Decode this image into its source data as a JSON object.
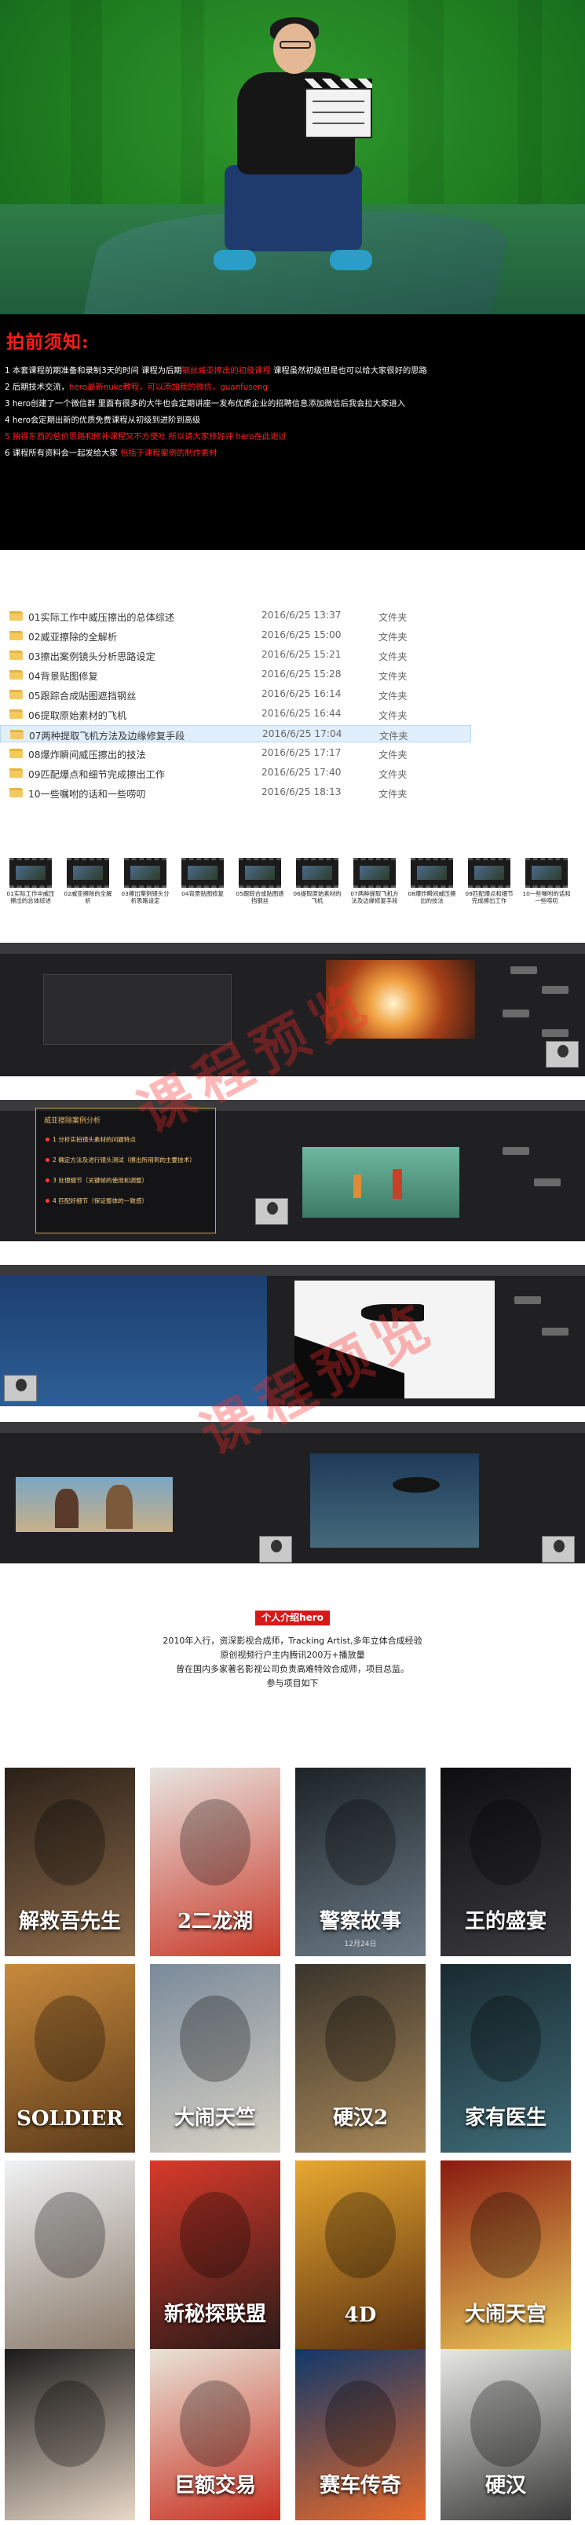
{
  "notice": {
    "title": "拍前须知:",
    "lines": [
      {
        "segments": [
          {
            "text": "1 本套课程前期准备和录制3天的时间 课程为后期",
            "red": false
          },
          {
            "text": "钢丝威亚擦出的初级课程",
            "red": true
          },
          {
            "text": "  课程虽然初级但是也可以给大家很好的思路",
            "red": false
          }
        ]
      },
      {
        "segments": [
          {
            "text": "2 后期技术交流，",
            "red": false
          },
          {
            "text": "hero最新nuke教程，可以添加我的微信，guanfuseng",
            "red": true
          }
        ]
      },
      {
        "segments": [
          {
            "text": "3 hero创建了一个微信群 里面有很多的大牛也会定期讲座一发布优质企业的招聘信息添加微信后我会拉大家进入",
            "red": false
          }
        ]
      },
      {
        "segments": [
          {
            "text": "4 hero会定期出新的优质免费课程从初级到进阶到高级",
            "red": false
          }
        ]
      },
      {
        "segments": [
          {
            "text": "5 拍得东西的总价思路和修补课程又不方便吐 所以请大家修好评 hero在此谢过",
            "red": true
          }
        ]
      },
      {
        "segments": [
          {
            "text": "6 课程所有资料会一起发给大家 ",
            "red": false
          },
          {
            "text": "包括于课程案例的制作素材",
            "red": true
          }
        ]
      }
    ]
  },
  "file_list": {
    "items": [
      {
        "name": "01实际工作中威压擦出的总体综述",
        "date": "2016/6/25 13:37",
        "type": "文件夹",
        "selected": false
      },
      {
        "name": "02威亚擦除的全解析",
        "date": "2016/6/25 15:00",
        "type": "文件夹",
        "selected": false
      },
      {
        "name": "03擦出案例镜头分析思路设定",
        "date": "2016/6/25 15:21",
        "type": "文件夹",
        "selected": false
      },
      {
        "name": "04背景贴图修复",
        "date": "2016/6/25 15:28",
        "type": "文件夹",
        "selected": false
      },
      {
        "name": "05跟踪合成贴图遮挡钢丝",
        "date": "2016/6/25 16:14",
        "type": "文件夹",
        "selected": false
      },
      {
        "name": "06提取原始素材的飞机",
        "date": "2016/6/25 16:44",
        "type": "文件夹",
        "selected": false
      },
      {
        "name": "07两种提取飞机方法及边缘修复手段",
        "date": "2016/6/25 17:04",
        "type": "文件夹",
        "selected": true
      },
      {
        "name": "08爆炸瞬间威压擦出的技法",
        "date": "2016/6/25 17:17",
        "type": "文件夹",
        "selected": false
      },
      {
        "name": "09匹配爆点和细节完成擦出工作",
        "date": "2016/6/25 17:40",
        "type": "文件夹",
        "selected": false
      },
      {
        "name": "10一些嘱咐的话和一些唠叨",
        "date": "2016/6/25 18:13",
        "type": "文件夹",
        "selected": false
      }
    ]
  },
  "thumbnails": [
    "01实际工作中威压擦出的总体综述",
    "02威亚擦除的全解析",
    "03擦出案例镜头分析思路设定",
    "04背景贴图修复",
    "05跟踪合成贴图遮挡钢丝",
    "06提取原始素材的飞机",
    "07两种提取飞机方法及边缘修复手段",
    "08爆炸瞬间威压擦出的技法",
    "09匹配爆点和细节完成擦出工作",
    "10一些嘱咐的话和一些唠叨"
  ],
  "preview": {
    "watermark": "课程预览",
    "outline_title": "威亚擦除案例分析",
    "outline_items": [
      "1 分析实拍镜头素材的问题特点",
      "2 确定方法及进行镜头测试（擦出所用到的主要技术）",
      "3 处理细节（关键帧的使用和调整）",
      "4 匹配好细节（保证整体的一致感）"
    ]
  },
  "bio": {
    "tag": "个人介绍hero",
    "lines": [
      "2010年入行，资深影视合成师，Tracking Artist,多年立体合成经验",
      "原创视频行户主内腾讯200万+播放量",
      "曾在国内多家著名影视公司负责高难特效合成师，项目总监。",
      "参与项目如下"
    ]
  },
  "posters": [
    {
      "title": "解救吾先生",
      "sub": "",
      "colors": [
        "#2a2018",
        "#8a6a4a"
      ]
    },
    {
      "title": "2二龙湖",
      "sub": "",
      "colors": [
        "#e8e4e0",
        "#c93a2a"
      ]
    },
    {
      "title": "警察故事",
      "sub": "12月24日",
      "colors": [
        "#1c2328",
        "#6d7b86"
      ]
    },
    {
      "title": "王的盛宴",
      "sub": "",
      "colors": [
        "#0e0e10",
        "#3b3b40"
      ]
    },
    {
      "title": "SOLDIER",
      "sub": "",
      "colors": [
        "#c88a3c",
        "#5a3a1a"
      ]
    },
    {
      "title": "大闹天竺",
      "sub": "",
      "colors": [
        "#7a8a9a",
        "#d8d2c4"
      ]
    },
    {
      "title": "硬汉2",
      "sub": "",
      "colors": [
        "#3a342c",
        "#a88858"
      ]
    },
    {
      "title": "家有医生",
      "sub": "",
      "colors": [
        "#1a2a30",
        "#3e6c78"
      ]
    },
    {
      "title": "",
      "sub": "",
      "colors": [
        "#f0f2f4",
        "#8a7a6a"
      ]
    },
    {
      "title": "新秘探联盟",
      "sub": "",
      "colors": [
        "#d83a2a",
        "#2a1a18"
      ]
    },
    {
      "title": "4D",
      "sub": "",
      "colors": [
        "#e8a830",
        "#5a3010"
      ]
    },
    {
      "title": "大闹天宫",
      "sub": "",
      "colors": [
        "#8a1a10",
        "#e8c858"
      ]
    },
    {
      "title": "",
      "sub": "",
      "colors": [
        "#1a1a1a",
        "#e8d8c8"
      ]
    },
    {
      "title": "巨额交易",
      "sub": "",
      "colors": [
        "#e8e4d8",
        "#c83020"
      ]
    },
    {
      "title": "赛车传奇",
      "sub": "",
      "colors": [
        "#10386a",
        "#e86a2a"
      ]
    },
    {
      "title": "硬汉",
      "sub": "",
      "colors": [
        "#e8e8e4",
        "#3a3a3a"
      ]
    }
  ]
}
